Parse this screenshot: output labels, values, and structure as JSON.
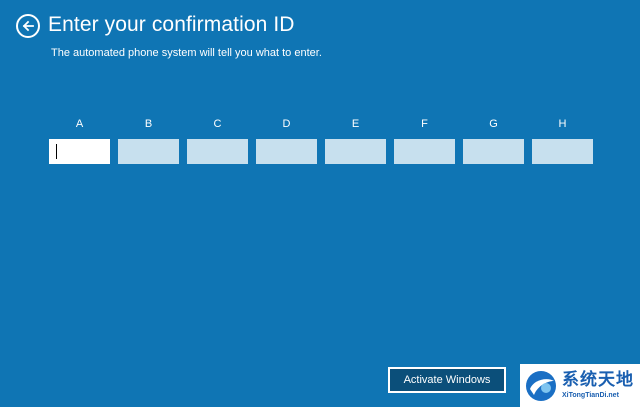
{
  "header": {
    "title": "Enter your confirmation ID",
    "subtitle": "The automated phone system will tell you what to enter."
  },
  "fields": [
    {
      "label": "A",
      "value": ""
    },
    {
      "label": "B",
      "value": ""
    },
    {
      "label": "C",
      "value": ""
    },
    {
      "label": "D",
      "value": ""
    },
    {
      "label": "E",
      "value": ""
    },
    {
      "label": "F",
      "value": ""
    },
    {
      "label": "G",
      "value": ""
    },
    {
      "label": "H",
      "value": ""
    }
  ],
  "footer": {
    "activate_label": "Activate Windows"
  },
  "watermark": {
    "cn_text": "系统天地",
    "en_text": "XiTongTianDi.net"
  },
  "icons": {
    "back": "back-arrow-icon",
    "logo": "xitongtiandi-logo-icon"
  },
  "colors": {
    "background": "#0f75b4",
    "field_inactive": "#c7e0ee",
    "field_active": "#ffffff",
    "button_bg": "#0b4f7a"
  }
}
